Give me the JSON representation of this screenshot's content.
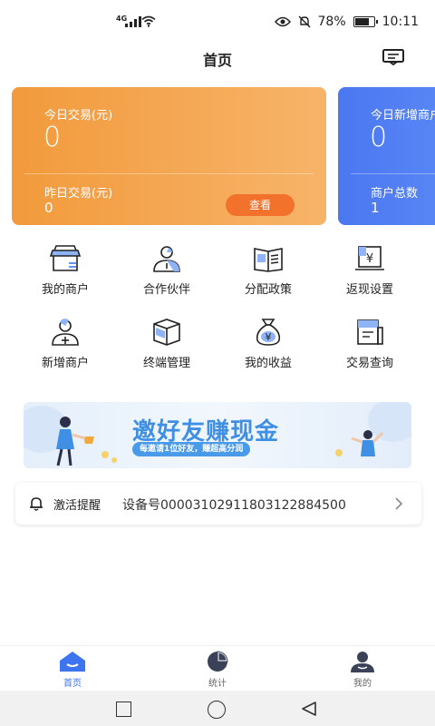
{
  "status_bar": {
    "network": "4G",
    "battery": "78%",
    "battery_level": 0.78,
    "time": "10:11"
  },
  "header": {
    "title": "首页"
  },
  "cards": [
    {
      "label_today": "今日交易(元)",
      "value_today": "0",
      "label_yesterday": "昨日交易(元)",
      "value_yesterday": "0",
      "button": "查看"
    },
    {
      "label_today": "今日新增商户",
      "value_today": "0",
      "label_total": "商户总数",
      "value_total": "1"
    }
  ],
  "grid": [
    {
      "label": "我的商户",
      "icon": "store-icon"
    },
    {
      "label": "合作伙伴",
      "icon": "partner-icon"
    },
    {
      "label": "分配政策",
      "icon": "policy-book-icon"
    },
    {
      "label": "返现设置",
      "icon": "cashback-icon"
    },
    {
      "label": "新增商户",
      "icon": "add-user-icon"
    },
    {
      "label": "终端管理",
      "icon": "terminal-box-icon"
    },
    {
      "label": "我的收益",
      "icon": "money-bag-icon"
    },
    {
      "label": "交易查询",
      "icon": "transaction-doc-icon"
    }
  ],
  "banner": {
    "title": "邀好友赚现金",
    "subtitle": "每邀请1位好友，赚超高分润"
  },
  "notice": {
    "title": "激活提醒",
    "detail": "设备号00003102911803122884500"
  },
  "tabs": [
    {
      "label": "首页",
      "icon": "home-icon",
      "active": true
    },
    {
      "label": "统计",
      "icon": "pie-chart-icon",
      "active": false
    },
    {
      "label": "我的",
      "icon": "profile-icon",
      "active": false
    }
  ],
  "colors": {
    "accent_blue": "#3d74f0",
    "card_orange": "#f29a3c",
    "card_blue": "#4b77f1",
    "button_orange": "#f2722c"
  }
}
